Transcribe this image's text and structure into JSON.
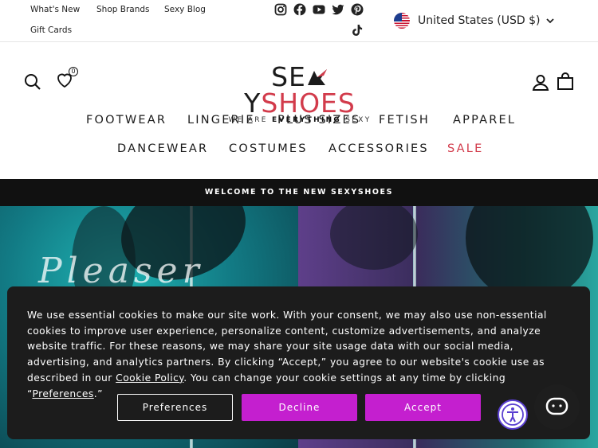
{
  "utility": {
    "links": [
      "What's New",
      "Shop Brands",
      "Sexy Blog",
      "Gift Cards"
    ],
    "social_icons": [
      "instagram-icon",
      "facebook-icon",
      "youtube-icon",
      "twitter-icon",
      "pinterest-icon",
      "tiktok-icon"
    ],
    "locale": "United States (USD $)"
  },
  "header": {
    "logo_dark": "SE",
    "logo_dark2": "Y",
    "logo_red": "SHOES",
    "tagline_1": "WE ARE ",
    "tagline_bold": "EVERYTHING",
    "tagline_2": " SEXY",
    "wishlist_count": "0"
  },
  "nav": {
    "row1": [
      "FOOTWEAR",
      "LINGERIE",
      "PLUS SIZES",
      "FETISH",
      "APPAREL"
    ],
    "row2": [
      "DANCEWEAR",
      "COSTUMES",
      "ACCESSORIES",
      "SALE"
    ]
  },
  "announcement": "WELCOME TO THE NEW SEXYSHOES",
  "cookie": {
    "text_1": "We use essential cookies to make our site work. With your consent, we may also use non-essential cookies to improve user experience, personalize content, customize advertisements, and analyze website traffic. For these reasons, we may share your site usage data with our social media, advertising, and analytics partners. By clicking “Accept,” you agree to our website's cookie use as described in our ",
    "policy_link": "Cookie Policy",
    "text_2": ". You can change your cookie settings at any time by clicking “",
    "pref_link": "Preferences",
    "text_3": ".”",
    "preferences_label": "Preferences",
    "decline_label": "Decline",
    "accept_label": "Accept"
  },
  "colors": {
    "brand_red": "#d23b4b",
    "button_magenta": "#c41fcf"
  }
}
